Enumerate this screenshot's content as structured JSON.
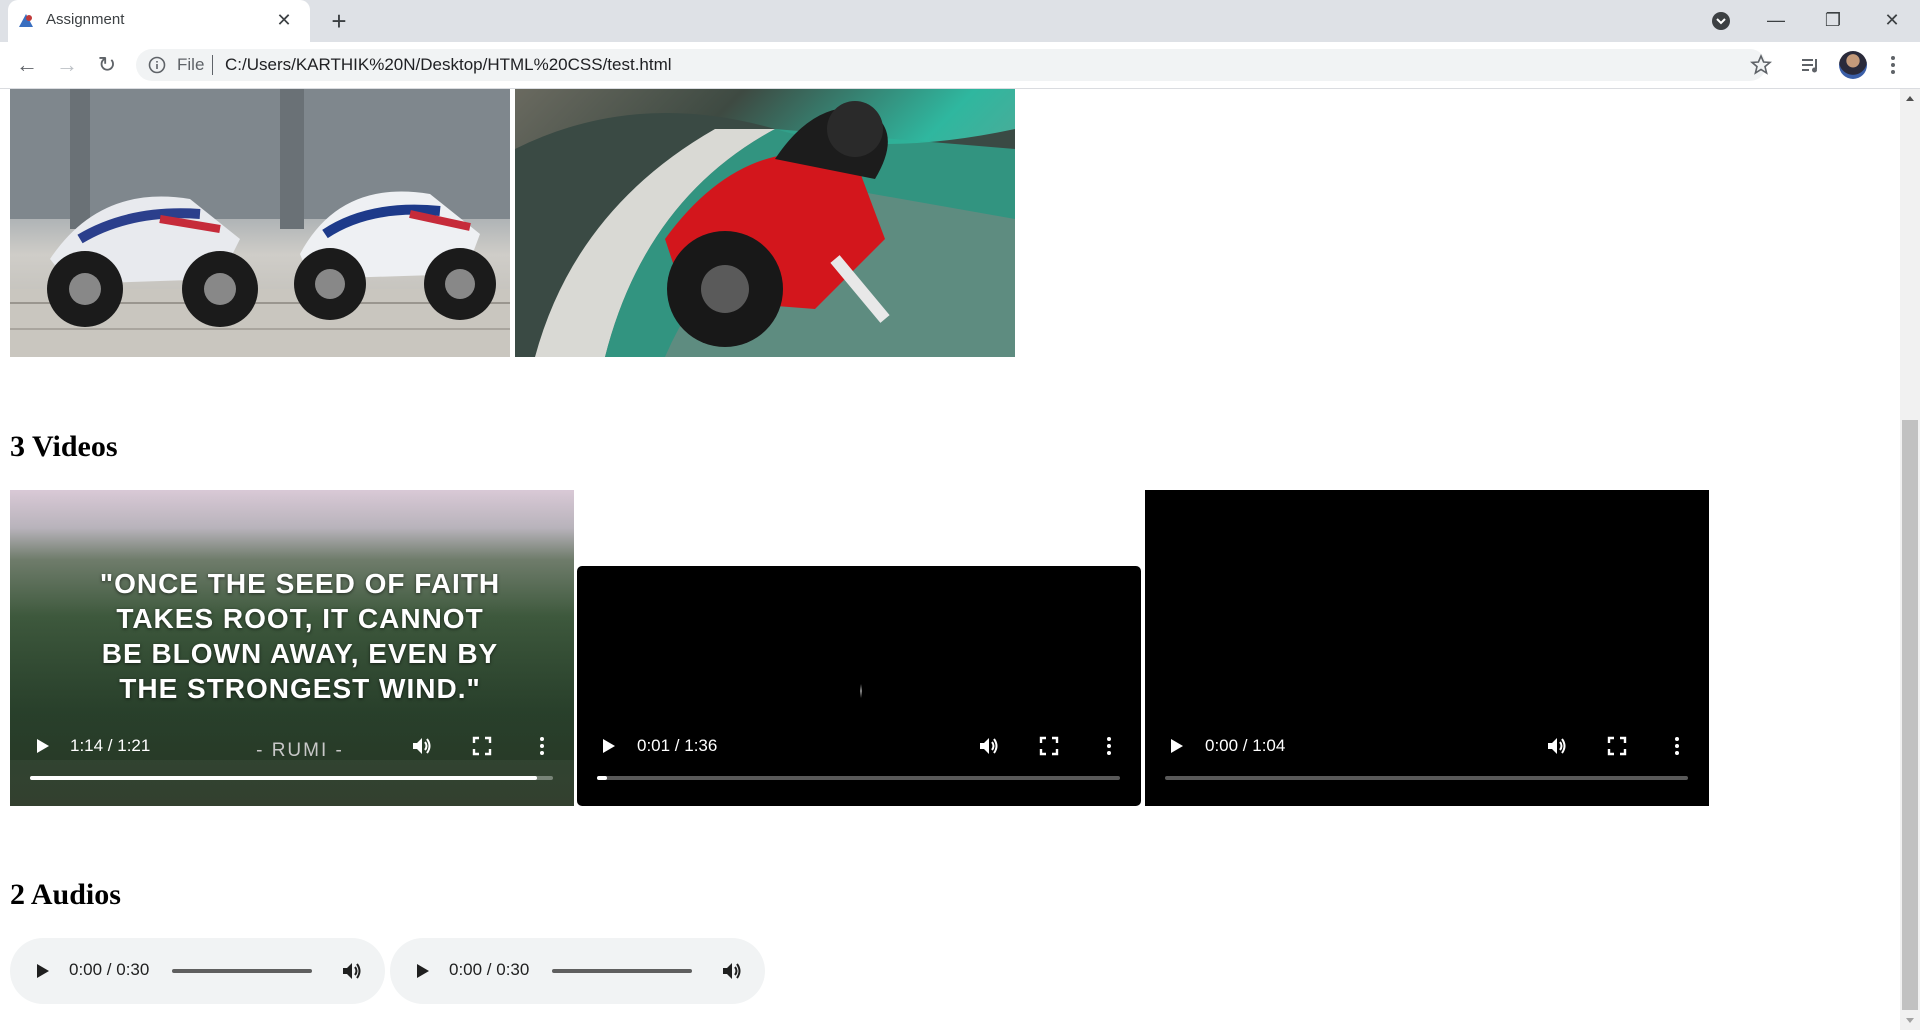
{
  "browser": {
    "tab_title": "Assignment",
    "url_scheme_label": "File",
    "url": "C:/Users/KARTHIK%20N/Desktop/HTML%20CSS/test.html"
  },
  "page": {
    "videos_heading": "3 Videos",
    "audios_heading": "2 Audios",
    "images": [
      {
        "subject": "two BMW superbikes on stands"
      },
      {
        "subject": "red Ducati motorcycle leaning on track"
      }
    ],
    "videos": [
      {
        "time": "1:14 / 1:21",
        "progress": 0.97,
        "quote_lines": [
          "\"ONCE THE SEED OF FAITH",
          "TAKES ROOT, IT CANNOT",
          "BE BLOWN AWAY, EVEN BY",
          "THE STRONGEST WIND.\""
        ],
        "quote_author": "- RUMI -"
      },
      {
        "time": "0:01 / 1:36",
        "progress": 0.02
      },
      {
        "time": "0:00 / 1:04",
        "progress": 0.0
      }
    ],
    "audios": [
      {
        "time": "0:00 / 0:30"
      },
      {
        "time": "0:00 / 0:30"
      }
    ]
  }
}
